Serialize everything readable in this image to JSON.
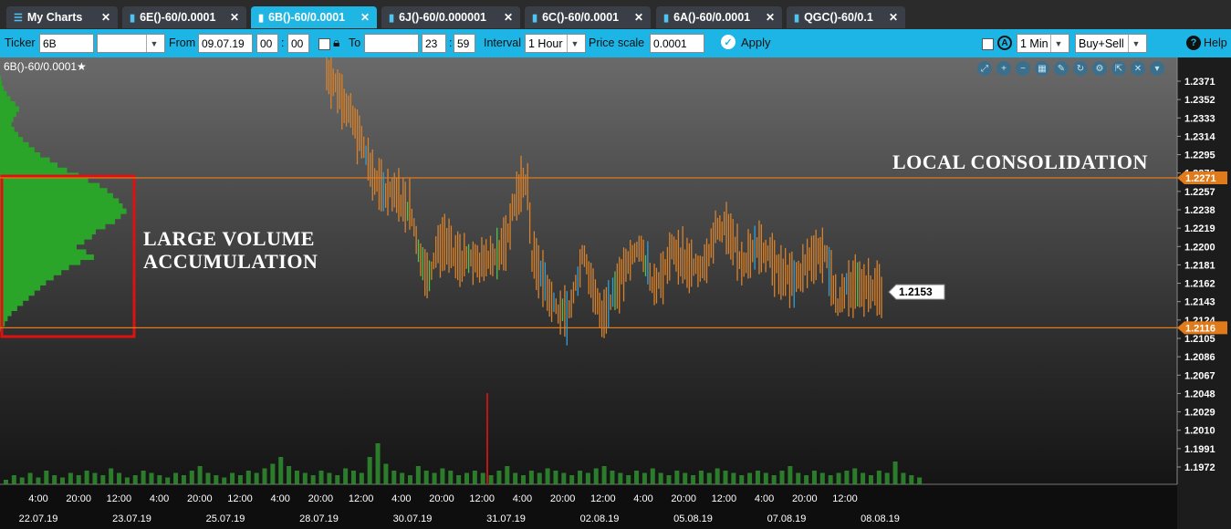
{
  "tabs": [
    {
      "label": "My Charts",
      "icon": "menu-icon"
    },
    {
      "label": "6E()-60/0.0001",
      "icon": "bar-chart-icon"
    },
    {
      "label": "6B()-60/0.0001",
      "icon": "bar-chart-icon",
      "active": true
    },
    {
      "label": "6J()-60/0.000001",
      "icon": "bar-chart-icon"
    },
    {
      "label": "6C()-60/0.0001",
      "icon": "bar-chart-icon"
    },
    {
      "label": "6A()-60/0.0001",
      "icon": "bar-chart-icon"
    },
    {
      "label": "QGC()-60/0.1",
      "icon": "bar-chart-icon"
    }
  ],
  "toolbar": {
    "ticker_label": "Ticker",
    "ticker_value": "6B",
    "from_label": "From",
    "from_date": "09.07.19",
    "from_hour": "00",
    "from_min": "00",
    "to_label": "To",
    "to_date": "",
    "to_hour": "23",
    "to_min": "59",
    "interval_label": "Interval",
    "interval_value": "1 Hour",
    "price_scale_label": "Price scale",
    "price_scale_value": "0.0001",
    "apply_label": "Apply",
    "right_interval": "1 Min",
    "side_value": "Buy+Sell",
    "help_label": "Help"
  },
  "chart_title": "6B()-60/0.0001★",
  "annotations": {
    "left": "LARGE VOLUME\nACCUMULATION",
    "right": "LOCAL CONSOLIDATION"
  },
  "colors": {
    "accent": "#1cb5e6",
    "candle": "#d9822b",
    "level_line": "#e07a1a",
    "volume": "#2f8f2f",
    "box": "#e01010"
  },
  "chart_data": {
    "type": "candlestick",
    "instrument": "6B()-60/0.0001",
    "interval": "1 Hour",
    "ylim": [
      1.1955,
      1.239
    ],
    "y_ticks": [
      "1.2371",
      "1.2352",
      "1.2333",
      "1.2314",
      "1.2295",
      "1.2276",
      "1.2257",
      "1.2238",
      "1.2219",
      "1.2200",
      "1.2181",
      "1.2162",
      "1.2143",
      "1.2124",
      "1.2105",
      "1.2086",
      "1.2067",
      "1.2048",
      "1.2029",
      "1.2010",
      "1.1991",
      "1.1972"
    ],
    "x_time_labels": [
      "4:00",
      "20:00",
      "12:00",
      "4:00",
      "20:00",
      "12:00",
      "4:00",
      "20:00",
      "12:00",
      "4:00",
      "20:00",
      "12:00",
      "4:00",
      "20:00",
      "12:00",
      "4:00",
      "20:00",
      "12:00",
      "4:00",
      "20:00",
      "12:00"
    ],
    "x_date_labels": [
      "22.07.19",
      "23.07.19",
      "25.07.19",
      "28.07.19",
      "30.07.19",
      "31.07.19",
      "02.08.19",
      "05.08.19",
      "07.08.19",
      "08.08.19"
    ],
    "levels": [
      {
        "label": "1.2271",
        "value": 1.2271
      },
      {
        "label": "1.2116",
        "value": 1.2116
      }
    ],
    "last_price": {
      "label": "1.2153",
      "value": 1.2153
    },
    "price_path": [
      [
        0,
        1.2382
      ],
      [
        3,
        1.236
      ],
      [
        6,
        1.233
      ],
      [
        9,
        1.2295
      ],
      [
        11,
        1.2268
      ],
      [
        13,
        1.2255
      ],
      [
        16,
        1.2252
      ],
      [
        19,
        1.224
      ],
      [
        21,
        1.22
      ],
      [
        23,
        1.2165
      ],
      [
        25,
        1.2195
      ],
      [
        27,
        1.2205
      ],
      [
        29,
        1.219
      ],
      [
        31,
        1.2185
      ],
      [
        33,
        1.2188
      ],
      [
        35,
        1.2182
      ],
      [
        37,
        1.2192
      ],
      [
        39,
        1.219
      ],
      [
        41,
        1.2205
      ],
      [
        43,
        1.2245
      ],
      [
        45,
        1.2268
      ],
      [
        46,
        1.2258
      ],
      [
        47,
        1.219
      ],
      [
        49,
        1.2175
      ],
      [
        51,
        1.215
      ],
      [
        53,
        1.2135
      ],
      [
        55,
        1.2125
      ],
      [
        57,
        1.216
      ],
      [
        59,
        1.2195
      ],
      [
        61,
        1.215
      ],
      [
        63,
        1.213
      ],
      [
        65,
        1.2145
      ],
      [
        67,
        1.2165
      ],
      [
        69,
        1.218
      ],
      [
        71,
        1.22
      ],
      [
        73,
        1.2185
      ],
      [
        75,
        1.216
      ],
      [
        77,
        1.217
      ],
      [
        79,
        1.2195
      ],
      [
        81,
        1.219
      ],
      [
        83,
        1.218
      ],
      [
        85,
        1.2175
      ],
      [
        87,
        1.219
      ],
      [
        89,
        1.2215
      ],
      [
        91,
        1.2222
      ],
      [
        93,
        1.22
      ],
      [
        95,
        1.2185
      ],
      [
        97,
        1.219
      ],
      [
        99,
        1.22
      ],
      [
        101,
        1.2192
      ],
      [
        103,
        1.2178
      ],
      [
        105,
        1.217
      ],
      [
        107,
        1.2165
      ],
      [
        109,
        1.2175
      ],
      [
        111,
        1.219
      ],
      [
        113,
        1.2195
      ],
      [
        115,
        1.218
      ],
      [
        117,
        1.214
      ],
      [
        119,
        1.216
      ],
      [
        121,
        1.2158
      ],
      [
        124,
        1.216
      ],
      [
        127,
        1.2153
      ]
    ],
    "volume_profile_note": "",
    "volume": [
      2,
      4,
      3,
      5,
      3,
      6,
      4,
      3,
      5,
      4,
      6,
      5,
      4,
      7,
      5,
      3,
      4,
      6,
      5,
      4,
      3,
      5,
      4,
      6,
      8,
      5,
      4,
      3,
      5,
      4,
      6,
      5,
      7,
      9,
      12,
      8,
      6,
      5,
      4,
      6,
      5,
      4,
      7,
      6,
      5,
      12,
      18,
      9,
      6,
      5,
      4,
      8,
      6,
      5,
      7,
      6,
      4,
      5,
      6,
      5,
      4,
      6,
      8,
      5,
      4,
      6,
      5,
      7,
      6,
      5,
      4,
      6,
      5,
      7,
      8,
      6,
      5,
      4,
      6,
      5,
      7,
      5,
      4,
      6,
      5,
      4,
      6,
      5,
      7,
      6,
      5,
      4,
      5,
      6,
      5,
      4,
      6,
      8,
      5,
      4,
      6,
      5,
      4,
      5,
      6,
      7,
      5,
      4,
      6,
      5,
      10,
      5,
      4,
      3
    ],
    "volume_profile": [
      1,
      2,
      4,
      7,
      11,
      16,
      20,
      17,
      14,
      12,
      15,
      19,
      24,
      30,
      36,
      42,
      52,
      60,
      70,
      82,
      92,
      104,
      112,
      118,
      124,
      128,
      132,
      126,
      120,
      110,
      100,
      96,
      88,
      80,
      90,
      98,
      84,
      72,
      64,
      56,
      48,
      42,
      36,
      30,
      24,
      18,
      12,
      8,
      5,
      3
    ]
  }
}
